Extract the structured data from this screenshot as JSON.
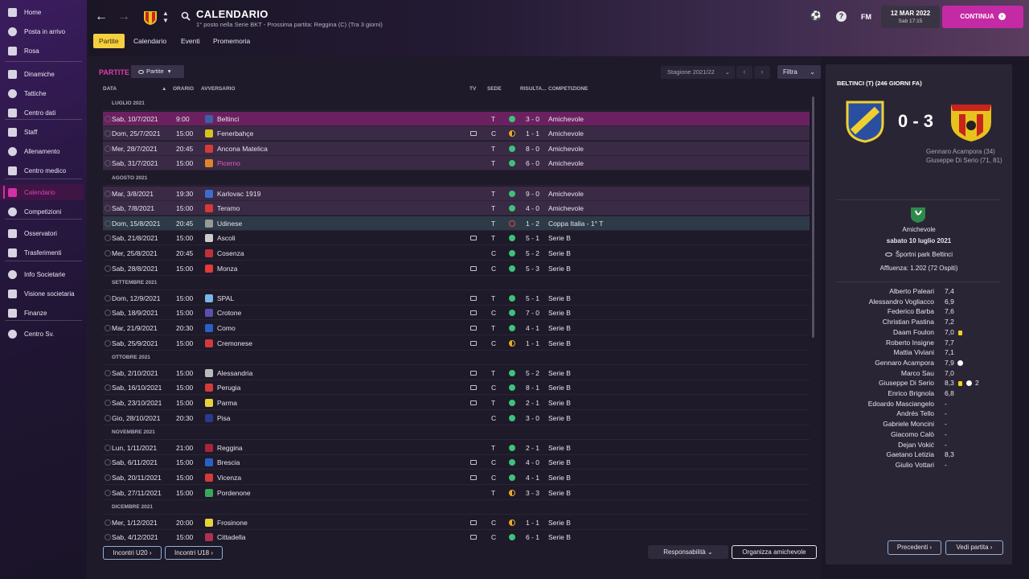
{
  "sidebar": {
    "items": [
      {
        "label": "Home",
        "icon": "home-icon"
      },
      {
        "label": "Posta in arrivo",
        "icon": "inbox-icon"
      },
      {
        "label": "Rosa",
        "icon": "shirt-icon"
      },
      {
        "label": "Dinamiche",
        "icon": "dynamics-icon"
      },
      {
        "label": "Tattiche",
        "icon": "tactics-icon"
      },
      {
        "label": "Centro dati",
        "icon": "data-icon"
      },
      {
        "label": "Staff",
        "icon": "staff-icon"
      },
      {
        "label": "Allenamento",
        "icon": "training-icon"
      },
      {
        "label": "Centro medico",
        "icon": "medical-icon"
      },
      {
        "label": "Calendario",
        "icon": "calendar-icon"
      },
      {
        "label": "Competizioni",
        "icon": "trophy-icon"
      },
      {
        "label": "Osservatori",
        "icon": "scout-icon"
      },
      {
        "label": "Trasferimenti",
        "icon": "transfer-icon"
      },
      {
        "label": "Info Societarie",
        "icon": "info-icon"
      },
      {
        "label": "Visione societaria",
        "icon": "vision-icon"
      },
      {
        "label": "Finanze",
        "icon": "finance-icon"
      },
      {
        "label": "Centro Sv.",
        "icon": "development-icon"
      }
    ]
  },
  "header": {
    "title": "CALENDARIO",
    "subtitle": "1° posto nella Serie BKT - Prossima partita: Reggina (C) (Tra 3 giorni)",
    "tabs": [
      "Partite",
      "Calendario",
      "Eventi",
      "Promemoria"
    ],
    "fm_label": "FM",
    "date": "12 MAR 2022",
    "date_sub": "Sab 17:15",
    "continue_label": "CONTINUA"
  },
  "main": {
    "section_title": "PARTITE",
    "matches_dropdown": "Partite",
    "season": "Stagione 2021/22",
    "filter": "Filtra",
    "columns": {
      "date": "DATA",
      "time": "ORARIO",
      "opponent": "AVVERSARIO",
      "tv": "TV",
      "venue": "SEDE",
      "result": "RISULTA...",
      "competition": "COMPETIZIONE"
    },
    "rows": [
      {
        "kind": "month",
        "label": "LUGLIO 2021"
      },
      {
        "kind": "match",
        "date": "Sab, 10/7/2021",
        "time": "9:00",
        "opponent": "Beltinci",
        "tv": false,
        "venue": "T",
        "result": "3 - 0",
        "outcome": "win",
        "competition": "Amichevole",
        "style": "sel",
        "crest": "#3d5fa8"
      },
      {
        "kind": "match",
        "date": "Dom, 25/7/2021",
        "time": "15:00",
        "opponent": "Fenerbahçe",
        "tv": true,
        "venue": "C",
        "result": "1 - 1",
        "outcome": "draw",
        "competition": "Amichevole",
        "style": "friendly",
        "crest": "#d9c21c"
      },
      {
        "kind": "match",
        "date": "Mer, 28/7/2021",
        "time": "20:45",
        "opponent": "Ancona Matelica",
        "tv": false,
        "venue": "T",
        "result": "8 - 0",
        "outcome": "win",
        "competition": "Amichevole",
        "style": "friendly",
        "crest": "#d43a3a"
      },
      {
        "kind": "match",
        "date": "Sab, 31/7/2021",
        "time": "15:00",
        "opponent": "Picerno",
        "tv": false,
        "venue": "T",
        "result": "6 - 0",
        "outcome": "win",
        "competition": "Amichevole",
        "style": "friendly",
        "crest": "#e0842a",
        "highlight": true
      },
      {
        "kind": "month",
        "label": "AGOSTO 2021"
      },
      {
        "kind": "match",
        "date": "Mar, 3/8/2021",
        "time": "19:30",
        "opponent": "Karlovac 1919",
        "tv": false,
        "venue": "T",
        "result": "9 - 0",
        "outcome": "win",
        "competition": "Amichevole",
        "style": "friendly",
        "crest": "#3d6bd0"
      },
      {
        "kind": "match",
        "date": "Sab, 7/8/2021",
        "time": "15:00",
        "opponent": "Teramo",
        "tv": false,
        "venue": "T",
        "result": "4 - 0",
        "outcome": "win",
        "competition": "Amichevole",
        "style": "friendly",
        "crest": "#d43a3a"
      },
      {
        "kind": "match",
        "date": "Dom, 15/8/2021",
        "time": "20:45",
        "opponent": "Udinese",
        "tv": false,
        "venue": "T",
        "result": "1 - 2",
        "outcome": "loss",
        "competition": "Coppa Italia - 1° T",
        "style": "hover",
        "crest": "#999999"
      },
      {
        "kind": "match",
        "date": "Sab, 21/8/2021",
        "time": "15:00",
        "opponent": "Ascoli",
        "tv": true,
        "venue": "T",
        "result": "5 - 1",
        "outcome": "win",
        "competition": "Serie B",
        "style": "",
        "crest": "#cccccc"
      },
      {
        "kind": "match",
        "date": "Mer, 25/8/2021",
        "time": "20:45",
        "opponent": "Cosenza",
        "tv": false,
        "venue": "C",
        "result": "5 - 2",
        "outcome": "win",
        "competition": "Serie B",
        "style": "",
        "crest": "#c0303a"
      },
      {
        "kind": "match",
        "date": "Sab, 28/8/2021",
        "time": "15:00",
        "opponent": "Monza",
        "tv": true,
        "venue": "C",
        "result": "5 - 3",
        "outcome": "win",
        "competition": "Serie B",
        "style": "",
        "crest": "#e03a3a"
      },
      {
        "kind": "month",
        "label": "SETTEMBRE 2021"
      },
      {
        "kind": "match",
        "date": "Dom, 12/9/2021",
        "time": "15:00",
        "opponent": "SPAL",
        "tv": true,
        "venue": "T",
        "result": "5 - 1",
        "outcome": "win",
        "competition": "Serie B",
        "style": "",
        "crest": "#7ab6e8"
      },
      {
        "kind": "match",
        "date": "Sab, 18/9/2021",
        "time": "15:00",
        "opponent": "Crotone",
        "tv": true,
        "venue": "C",
        "result": "7 - 0",
        "outcome": "win",
        "competition": "Serie B",
        "style": "",
        "crest": "#5b4fb0"
      },
      {
        "kind": "match",
        "date": "Mar, 21/9/2021",
        "time": "20:30",
        "opponent": "Como",
        "tv": true,
        "venue": "T",
        "result": "4 - 1",
        "outcome": "win",
        "competition": "Serie B",
        "style": "",
        "crest": "#2a5fc8"
      },
      {
        "kind": "match",
        "date": "Sab, 25/9/2021",
        "time": "15:00",
        "opponent": "Cremonese",
        "tv": true,
        "venue": "C",
        "result": "1 - 1",
        "outcome": "draw",
        "competition": "Serie B",
        "style": "",
        "crest": "#d43a3a"
      },
      {
        "kind": "month",
        "label": "OTTOBRE 2021"
      },
      {
        "kind": "match",
        "date": "Sab, 2/10/2021",
        "time": "15:00",
        "opponent": "Alessandria",
        "tv": true,
        "venue": "T",
        "result": "5 - 2",
        "outcome": "win",
        "competition": "Serie B",
        "style": "",
        "crest": "#bbbbbb"
      },
      {
        "kind": "match",
        "date": "Sab, 16/10/2021",
        "time": "15:00",
        "opponent": "Perugia",
        "tv": true,
        "venue": "C",
        "result": "8 - 1",
        "outcome": "win",
        "competition": "Serie B",
        "style": "",
        "crest": "#d43a3a"
      },
      {
        "kind": "match",
        "date": "Sab, 23/10/2021",
        "time": "15:00",
        "opponent": "Parma",
        "tv": true,
        "venue": "T",
        "result": "2 - 1",
        "outcome": "win",
        "competition": "Serie B",
        "style": "",
        "crest": "#e8d23a"
      },
      {
        "kind": "match",
        "date": "Gio, 28/10/2021",
        "time": "20:30",
        "opponent": "Pisa",
        "tv": false,
        "venue": "C",
        "result": "3 - 0",
        "outcome": "win",
        "competition": "Serie B",
        "style": "",
        "crest": "#2a3a8a"
      },
      {
        "kind": "month",
        "label": "NOVEMBRE 2021"
      },
      {
        "kind": "match",
        "date": "Lun, 1/11/2021",
        "time": "21:00",
        "opponent": "Reggina",
        "tv": false,
        "venue": "T",
        "result": "2 - 1",
        "outcome": "win",
        "competition": "Serie B",
        "style": "",
        "crest": "#a8243a"
      },
      {
        "kind": "match",
        "date": "Sab, 6/11/2021",
        "time": "15:00",
        "opponent": "Brescia",
        "tv": true,
        "venue": "C",
        "result": "4 - 0",
        "outcome": "win",
        "competition": "Serie B",
        "style": "",
        "crest": "#2a5fc8"
      },
      {
        "kind": "match",
        "date": "Sab, 20/11/2021",
        "time": "15:00",
        "opponent": "Vicenza",
        "tv": true,
        "venue": "C",
        "result": "4 - 1",
        "outcome": "win",
        "competition": "Serie B",
        "style": "",
        "crest": "#d43a3a"
      },
      {
        "kind": "match",
        "date": "Sab, 27/11/2021",
        "time": "15:00",
        "opponent": "Pordenone",
        "tv": false,
        "venue": "T",
        "result": "3 - 3",
        "outcome": "draw",
        "competition": "Serie B",
        "style": "",
        "crest": "#3aa85a"
      },
      {
        "kind": "month",
        "label": "DICEMBRE 2021"
      },
      {
        "kind": "match",
        "date": "Mer, 1/12/2021",
        "time": "20:00",
        "opponent": "Frosinone",
        "tv": true,
        "venue": "C",
        "result": "1 - 1",
        "outcome": "draw",
        "competition": "Serie B",
        "style": "",
        "crest": "#e8d23a"
      },
      {
        "kind": "match",
        "date": "Sab, 4/12/2021",
        "time": "15:00",
        "opponent": "Cittadella",
        "tv": true,
        "venue": "C",
        "result": "6 - 1",
        "outcome": "win",
        "competition": "Serie B",
        "style": "",
        "crest": "#b03050"
      }
    ],
    "footer": {
      "u20": "Incontri U20",
      "u18": "Incontri U18",
      "responsibility": "Responsabilità",
      "organize": "Organizza amichevole"
    }
  },
  "detail": {
    "title": "BELTINCI (T) (246 GIORNI FA)",
    "score": "0 - 3",
    "scorers": [
      "Gennaro Acampora (34)",
      "Giuseppe Di Serio (71, 81)"
    ],
    "competition": "Amichevole",
    "match_date": "sabato 10 luglio 2021",
    "stadium": "Športni park Beltinci",
    "attendance": "Affluenza: 1.202 (72 Ospiti)",
    "players": [
      {
        "name": "Alberto Paleari",
        "rating": "7,4"
      },
      {
        "name": "Alessandro Vogliacco",
        "rating": "6,9"
      },
      {
        "name": "Federico Barba",
        "rating": "7,6"
      },
      {
        "name": "Christian Pastina",
        "rating": "7,2"
      },
      {
        "name": "Daam Foulon",
        "rating": "7,0",
        "yellow": true
      },
      {
        "name": "Roberto Insigne",
        "rating": "7,7"
      },
      {
        "name": "Mattia Viviani",
        "rating": "7,1"
      },
      {
        "name": "Gennaro Acampora",
        "rating": "7,9",
        "goals": 1
      },
      {
        "name": "Marco Sau",
        "rating": "7,0"
      },
      {
        "name": "Giuseppe Di Serio",
        "rating": "8,3",
        "yellow": true,
        "goals": 2,
        "goal_count_label": "2"
      },
      {
        "name": "Enrico Brignola",
        "rating": "6,8"
      },
      {
        "name": "Edoardo Masciangelo",
        "rating": "-"
      },
      {
        "name": "Andrés Tello",
        "rating": "-"
      },
      {
        "name": "Gabriele Moncini",
        "rating": "-"
      },
      {
        "name": "Giacomo Calò",
        "rating": "-"
      },
      {
        "name": "Dejan Vokić",
        "rating": "-"
      },
      {
        "name": "Gaetano Letizia",
        "rating": "8,3"
      },
      {
        "name": "Giulio Vottari",
        "rating": "-"
      }
    ],
    "prev_label": "Precedenti",
    "next_label": "Vedi partita"
  },
  "colors": {
    "accent": "#c52aa5",
    "win": "#3ec27a",
    "draw": "#e8a92a",
    "loss": "#e04848",
    "tab_active": "#f4d03f"
  }
}
